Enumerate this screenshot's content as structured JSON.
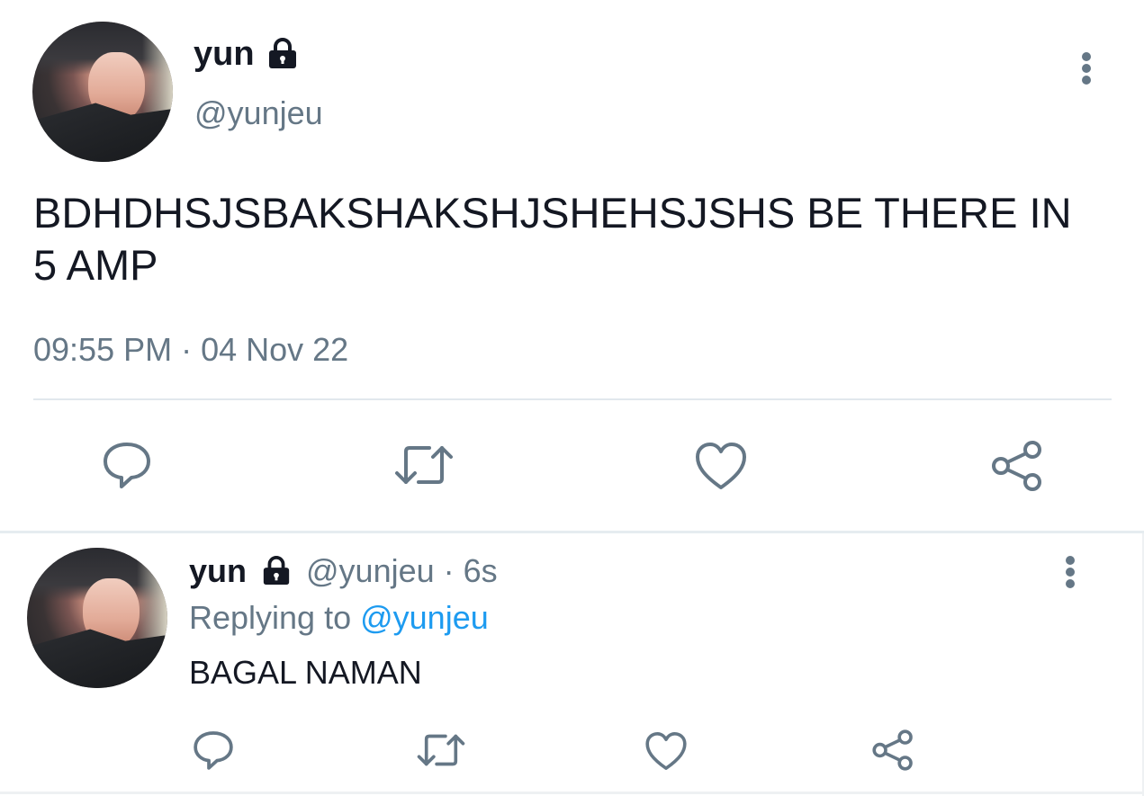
{
  "main_tweet": {
    "display_name": "yun",
    "handle": "@yunjeu",
    "text_line1": "BDHDHSJSBAKSHAKSHJSHEHSJSHS BE THERE IN",
    "text_line2": "5 AMP",
    "timestamp": "09:55 PM · 04 Nov 22",
    "icons": {
      "lock": "lock-icon",
      "more": "more-vertical-icon",
      "reply": "reply-icon",
      "retweet": "retweet-icon",
      "like": "heart-icon",
      "share": "share-icon"
    }
  },
  "reply_tweet": {
    "display_name": "yun",
    "handle_time": "@yunjeu · 6s",
    "replying_prefix": "Replying to ",
    "replying_to": "@yunjeu",
    "text": "BAGAL NAMAN"
  },
  "colors": {
    "text": "#141823",
    "secondary": "#657786",
    "mention": "#1d9bf0",
    "divider": "#e1e8ed"
  }
}
